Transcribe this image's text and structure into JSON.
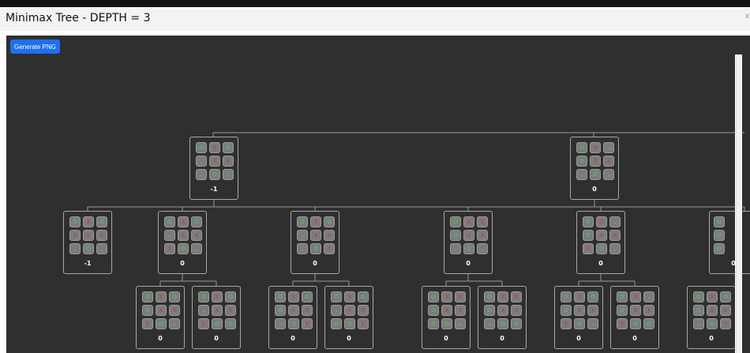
{
  "window": {
    "title": "Minimax Tree - DEPTH = 3",
    "close_label": "x"
  },
  "toolbar": {
    "generate_png_label": "Generate PNG"
  },
  "colors": {
    "O": "#41d35c",
    "X": "#c8342c",
    "empty": "#d8d8d8",
    "accent": "#1f6ff0"
  },
  "tree": {
    "nodes": [
      {
        "board": [
          "O",
          "X",
          "O",
          ".",
          "X",
          "X",
          ".",
          "O",
          "."
        ],
        "score": "-1"
      },
      {
        "board": [
          "O",
          "X",
          ".",
          "O",
          "X",
          "X",
          ".",
          "O",
          "."
        ],
        "score": "0"
      },
      {
        "board": [
          "O",
          "X",
          "O",
          "X",
          "X",
          "X",
          ".",
          "O",
          "."
        ],
        "score": "-1"
      },
      {
        "board": [
          "O",
          "X",
          "O",
          ".",
          "X",
          "X",
          "X",
          "O",
          "."
        ],
        "score": "0"
      },
      {
        "board": [
          "O",
          "X",
          "O",
          ".",
          "X",
          "X",
          ".",
          "O",
          "X"
        ],
        "score": "0"
      },
      {
        "board": [
          "O",
          "X",
          "X",
          "O",
          "X",
          "X",
          ".",
          "O",
          "."
        ],
        "score": "0"
      },
      {
        "board": [
          "O",
          "X",
          ".",
          "O",
          "X",
          "X",
          "X",
          "O",
          "."
        ],
        "score": "0"
      },
      {
        "board": [
          "O",
          "X",
          "O",
          "O",
          "X",
          "X",
          "X",
          "O",
          "."
        ],
        "score": "0"
      },
      {
        "board": [
          "O",
          "X",
          "O",
          ".",
          "X",
          "X",
          "X",
          "O",
          "O"
        ],
        "score": "0"
      },
      {
        "board": [
          "O",
          "X",
          "O",
          "O",
          "X",
          "X",
          ".",
          "O",
          "X"
        ],
        "score": "0"
      },
      {
        "board": [
          "O",
          "X",
          "O",
          ".",
          "X",
          "X",
          "O",
          "O",
          "X"
        ],
        "score": "0"
      },
      {
        "board": [
          "O",
          "X",
          "X",
          "O",
          "X",
          "X",
          "O",
          "O",
          "."
        ],
        "score": "0"
      },
      {
        "board": [
          "O",
          "X",
          "X",
          "O",
          "X",
          "X",
          ".",
          "O",
          "O"
        ],
        "score": "0"
      },
      {
        "board": [
          "O",
          "X",
          "O",
          "O",
          "X",
          "X",
          "X",
          "O",
          "."
        ],
        "score": "0"
      },
      {
        "board": [
          "O",
          "X",
          ".",
          "O",
          "X",
          "X",
          "X",
          "O",
          "O"
        ],
        "score": "0"
      },
      {
        "board": [
          "O",
          "X",
          "O",
          "O",
          "X",
          "X",
          ".",
          "O",
          "X"
        ],
        "score": "0"
      }
    ],
    "partial": {
      "board": [
        "O",
        "",
        "O",
        "",
        "O",
        ""
      ],
      "score": "0"
    }
  }
}
